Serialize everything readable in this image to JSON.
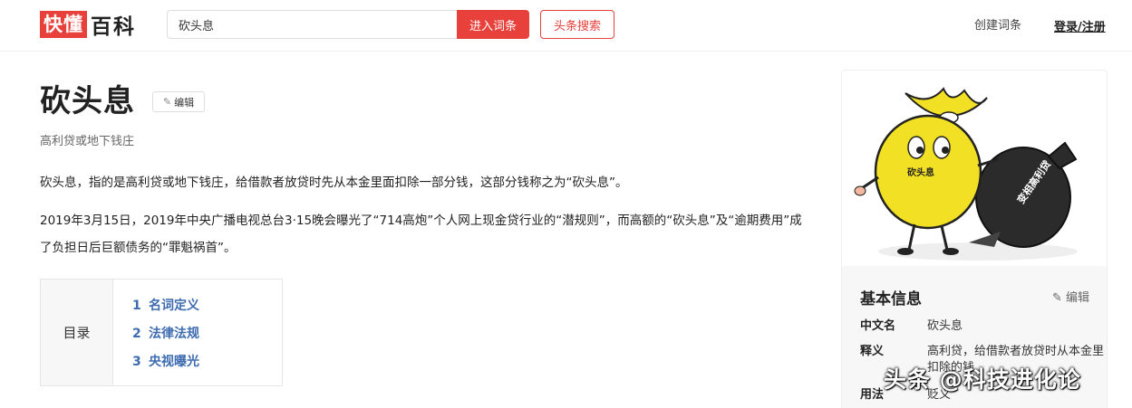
{
  "header": {
    "logo_red": "快懂",
    "logo_text": "百科",
    "search_value": "砍头息",
    "enter_button": "进入词条",
    "toutiao_button": "头条搜索",
    "create_link": "创建词条",
    "login_link": "登录/注册"
  },
  "article": {
    "title": "砍头息",
    "edit_label": "编辑",
    "subtitle": "高利贷或地下钱庄",
    "paragraphs": [
      "砍头息，指的是高利贷或地下钱庄，给借款者放贷时先从本金里面扣除一部分钱，这部分钱称之为“砍头息”。",
      "2019年3月15日，2019年中央广播电视总台3·15晚会曝光了“714高炮”个人网上现金贷行业的“潜规则”，而高额的“砍头息”及“逾期费用”成了负担日后巨额债务的“罪魁祸首”。"
    ],
    "toc": {
      "label": "目录",
      "items": [
        {
          "num": "1",
          "text": "名词定义"
        },
        {
          "num": "2",
          "text": "法律法规"
        },
        {
          "num": "3",
          "text": "央视曝光"
        }
      ]
    }
  },
  "sidebar": {
    "image_texts": {
      "bag_label": "砍头息",
      "dark_bag_label": "变相高利贷"
    },
    "info_title": "基本信息",
    "info_edit": "编辑",
    "rows": [
      {
        "key": "中文名",
        "value": "砍头息"
      },
      {
        "key": "释义",
        "value": "高利贷，给借款者放贷时从本金里扣除的钱"
      },
      {
        "key": "用法",
        "value": "贬义"
      }
    ]
  },
  "watermark": "头条 @科技进化论",
  "colors": {
    "brand_red": "#e8413b",
    "link_blue": "#3d6bb0"
  }
}
